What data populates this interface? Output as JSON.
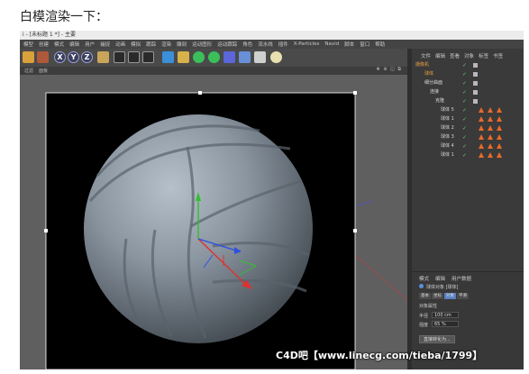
{
  "post": {
    "title": "白模渲染一下："
  },
  "window": {
    "title": "i - [未标题 1 *] - 主要",
    "menu": [
      "模型",
      "创建",
      "模式",
      "编辑",
      "用户",
      "捕捉",
      "动画",
      "模拟",
      "跟踪",
      "渲染",
      "雕刻",
      "运动图形",
      "运动跟踪",
      "角色",
      "流水线",
      "插件",
      "X-Particles",
      "Navid",
      "脚本",
      "窗口",
      "帮助"
    ],
    "viewport_menu": [
      "过滤",
      "面板"
    ],
    "viewport_icons": "✥ ⊕ ◱ ⧉"
  },
  "toolbar": {
    "letters": [
      "X",
      "Y",
      "Z"
    ]
  },
  "object_manager": {
    "tabs": [
      "文件",
      "编辑",
      "查看",
      "对象",
      "标签",
      "书签"
    ],
    "objects": [
      {
        "name": "摄像机",
        "indent": 0
      },
      {
        "name": "球体",
        "indent": 1
      },
      {
        "name": "细分曲面",
        "indent": 1
      },
      {
        "name": "连接",
        "indent": 2
      },
      {
        "name": "克隆",
        "indent": 3
      },
      {
        "name": "球体 5",
        "indent": 4
      },
      {
        "name": "球体 1",
        "indent": 4
      },
      {
        "name": "球体 2",
        "indent": 4
      },
      {
        "name": "球体 3",
        "indent": 4
      },
      {
        "name": "球体 4",
        "indent": 4
      },
      {
        "name": "球体 1",
        "indent": 4
      }
    ]
  },
  "attributes": {
    "tabs": [
      "模式",
      "编辑",
      "用户数据"
    ],
    "object_label": "球体对象 [球体]",
    "subtabs": [
      "基本",
      "坐标",
      "对象",
      "平滑"
    ],
    "section": "对象属性",
    "radius_label": "半径",
    "radius_value": "100 cm",
    "segments_label": "强度",
    "segments_value": "65 %",
    "button_label": "直接转化为..."
  },
  "watermark": {
    "text": "C4D吧【www.linecg.com/tieba/1799】"
  },
  "colors": {
    "render_bg": "#000000",
    "ball": "#8b96a1",
    "axis_x": "#e03030",
    "axis_y": "#30c030",
    "axis_z": "#3050e0"
  }
}
